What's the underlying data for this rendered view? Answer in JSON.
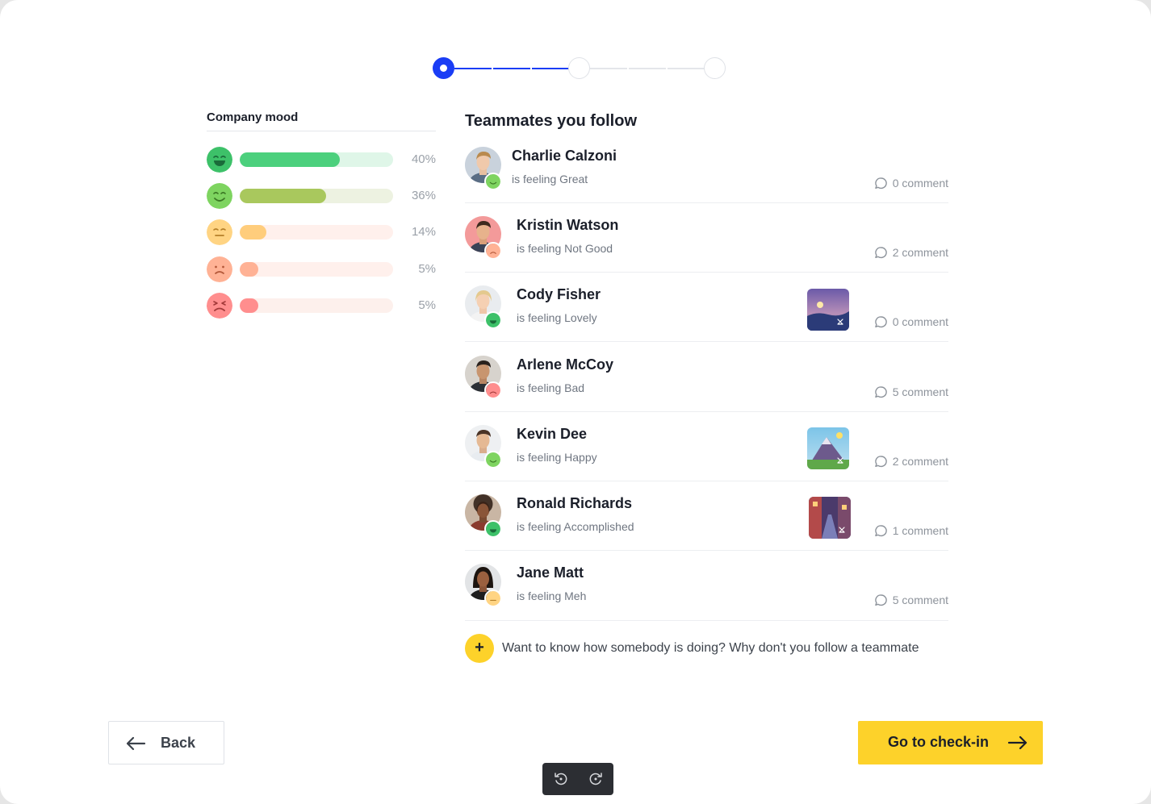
{
  "stepper": {
    "current_step": 1,
    "total_steps": 3
  },
  "mood": {
    "title": "Company mood",
    "rows": [
      {
        "face": "great-face-icon",
        "percent": "40%",
        "fraction": 0.655,
        "color": "#4cd07d",
        "track": "#dff6e8"
      },
      {
        "face": "happy-face-icon",
        "percent": "36%",
        "fraction": 0.565,
        "color": "#a9c85d",
        "track": "#edf2e1"
      },
      {
        "face": "meh-face-icon",
        "percent": "14%",
        "fraction": 0.175,
        "color": "#ffcd7c",
        "track": "#fff0ec"
      },
      {
        "face": "not-good-face-icon",
        "percent": "5%",
        "fraction": 0.12,
        "color": "#ffb295",
        "track": "#fff0ec"
      },
      {
        "face": "bad-face-icon",
        "percent": "5%",
        "fraction": 0.12,
        "color": "#ff8e8e",
        "track": "#fdf0ec"
      }
    ]
  },
  "teammates": {
    "title": "Teammates you follow",
    "items": [
      {
        "name": "Charlie Calzoni",
        "status": "is feeling Great",
        "comments": "0 comment",
        "mood_color": "#7ed460",
        "has_photo": false
      },
      {
        "name": "Kristin Watson",
        "status": "is feeling Not Good",
        "comments": "2 comment",
        "mood_color": "#ffb295",
        "has_photo": false
      },
      {
        "name": "Cody Fisher",
        "status": "is feeling Lovely",
        "comments": "0 comment",
        "mood_color": "#3dc169",
        "has_photo": true
      },
      {
        "name": "Arlene McCoy",
        "status": "is feeling Bad",
        "comments": "5 comment",
        "mood_color": "#ff8e8e",
        "has_photo": false
      },
      {
        "name": "Kevin Dee",
        "status": "is feeling Happy",
        "comments": "2 comment",
        "mood_color": "#7ed460",
        "has_photo": true
      },
      {
        "name": "Ronald Richards",
        "status": "is feeling Accomplished",
        "comments": "1 comment",
        "mood_color": "#3dc169",
        "has_photo": true
      },
      {
        "name": "Jane Matt",
        "status": "is feeling Meh",
        "comments": "5 comment",
        "mood_color": "#ffcd7c",
        "has_photo": false
      }
    ]
  },
  "follow_prompt": {
    "plus": "+",
    "text": "Want to know how somebody is doing? Why don't you follow a teammate"
  },
  "actions": {
    "back_label": "Back",
    "checkin_label": "Go to check-in"
  },
  "colors": {
    "accent": "#1a3df5",
    "primary_button": "#fdd22a"
  }
}
